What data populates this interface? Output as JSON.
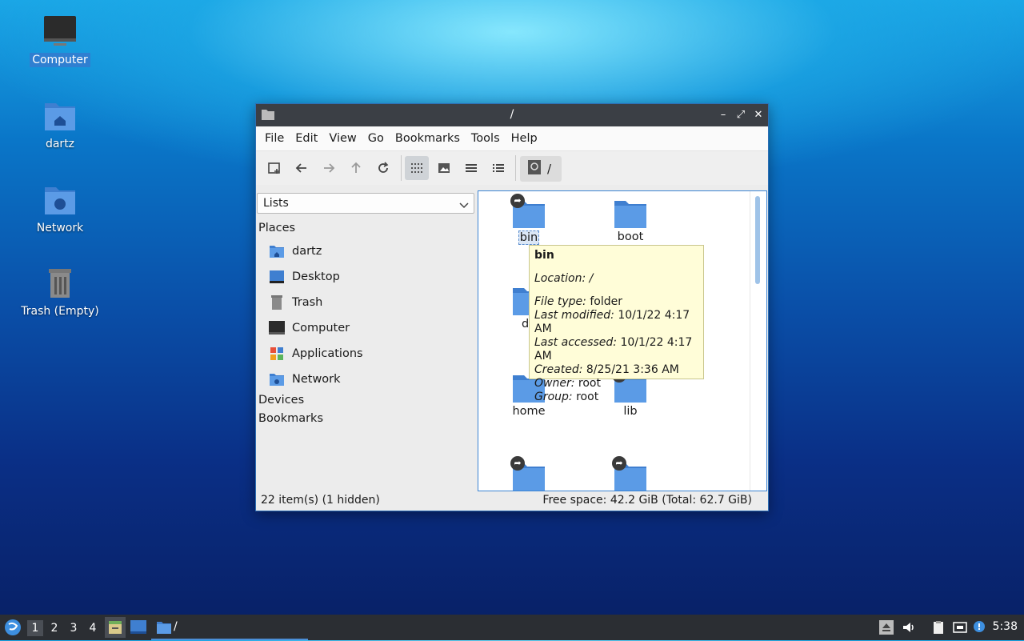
{
  "desktop": {
    "icons": [
      {
        "label": "Computer",
        "icon": "computer-icon",
        "selected": true
      },
      {
        "label": "dartz",
        "icon": "home-folder-icon"
      },
      {
        "label": "Network",
        "icon": "network-folder-icon"
      },
      {
        "label": "Trash (Empty)",
        "icon": "trash-icon"
      }
    ]
  },
  "window": {
    "title": "/",
    "menu": [
      "File",
      "Edit",
      "View",
      "Go",
      "Bookmarks",
      "Tools",
      "Help"
    ],
    "path": "/",
    "side_select": "Lists",
    "sections": {
      "places": "Places",
      "devices": "Devices",
      "bookmarks": "Bookmarks"
    },
    "places": [
      {
        "label": "dartz",
        "icon": "home-folder-icon"
      },
      {
        "label": "Desktop",
        "icon": "desktop-icon"
      },
      {
        "label": "Trash",
        "icon": "trash-icon"
      },
      {
        "label": "Computer",
        "icon": "computer-icon"
      },
      {
        "label": "Applications",
        "icon": "applications-icon"
      },
      {
        "label": "Network",
        "icon": "network-folder-icon"
      }
    ],
    "files": [
      {
        "name": "bin",
        "link": true,
        "selected": true
      },
      {
        "name": "boot",
        "link": false
      },
      {
        "name": "de",
        "link": false
      },
      {
        "name": "home",
        "link": false
      },
      {
        "name": "lib",
        "link": true
      },
      {
        "name": "",
        "link": true
      },
      {
        "name": "",
        "link": true
      }
    ],
    "status_left": "22 item(s) (1 hidden)",
    "status_right": "Free space: 42.2 GiB (Total: 62.7 GiB)"
  },
  "tooltip": {
    "name": "bin",
    "location_label": "Location:",
    "location": "/",
    "type_label": "File type:",
    "type": "folder",
    "modified_label": "Last modified:",
    "modified": "10/1/22 4:17 AM",
    "accessed_label": "Last accessed:",
    "accessed": "10/1/22 4:17 AM",
    "created_label": "Created:",
    "created": "8/25/21 3:36 AM",
    "owner_label": "Owner:",
    "owner": "root",
    "group_label": "Group:",
    "group": "root"
  },
  "taskbar": {
    "workspaces": [
      "1",
      "2",
      "3",
      "4"
    ],
    "task_title": "/",
    "clock": "5:38"
  },
  "colors": {
    "folder": "#4a8ee0",
    "accent": "#2f7fd1",
    "tooltip_bg": "#fffdd8"
  }
}
